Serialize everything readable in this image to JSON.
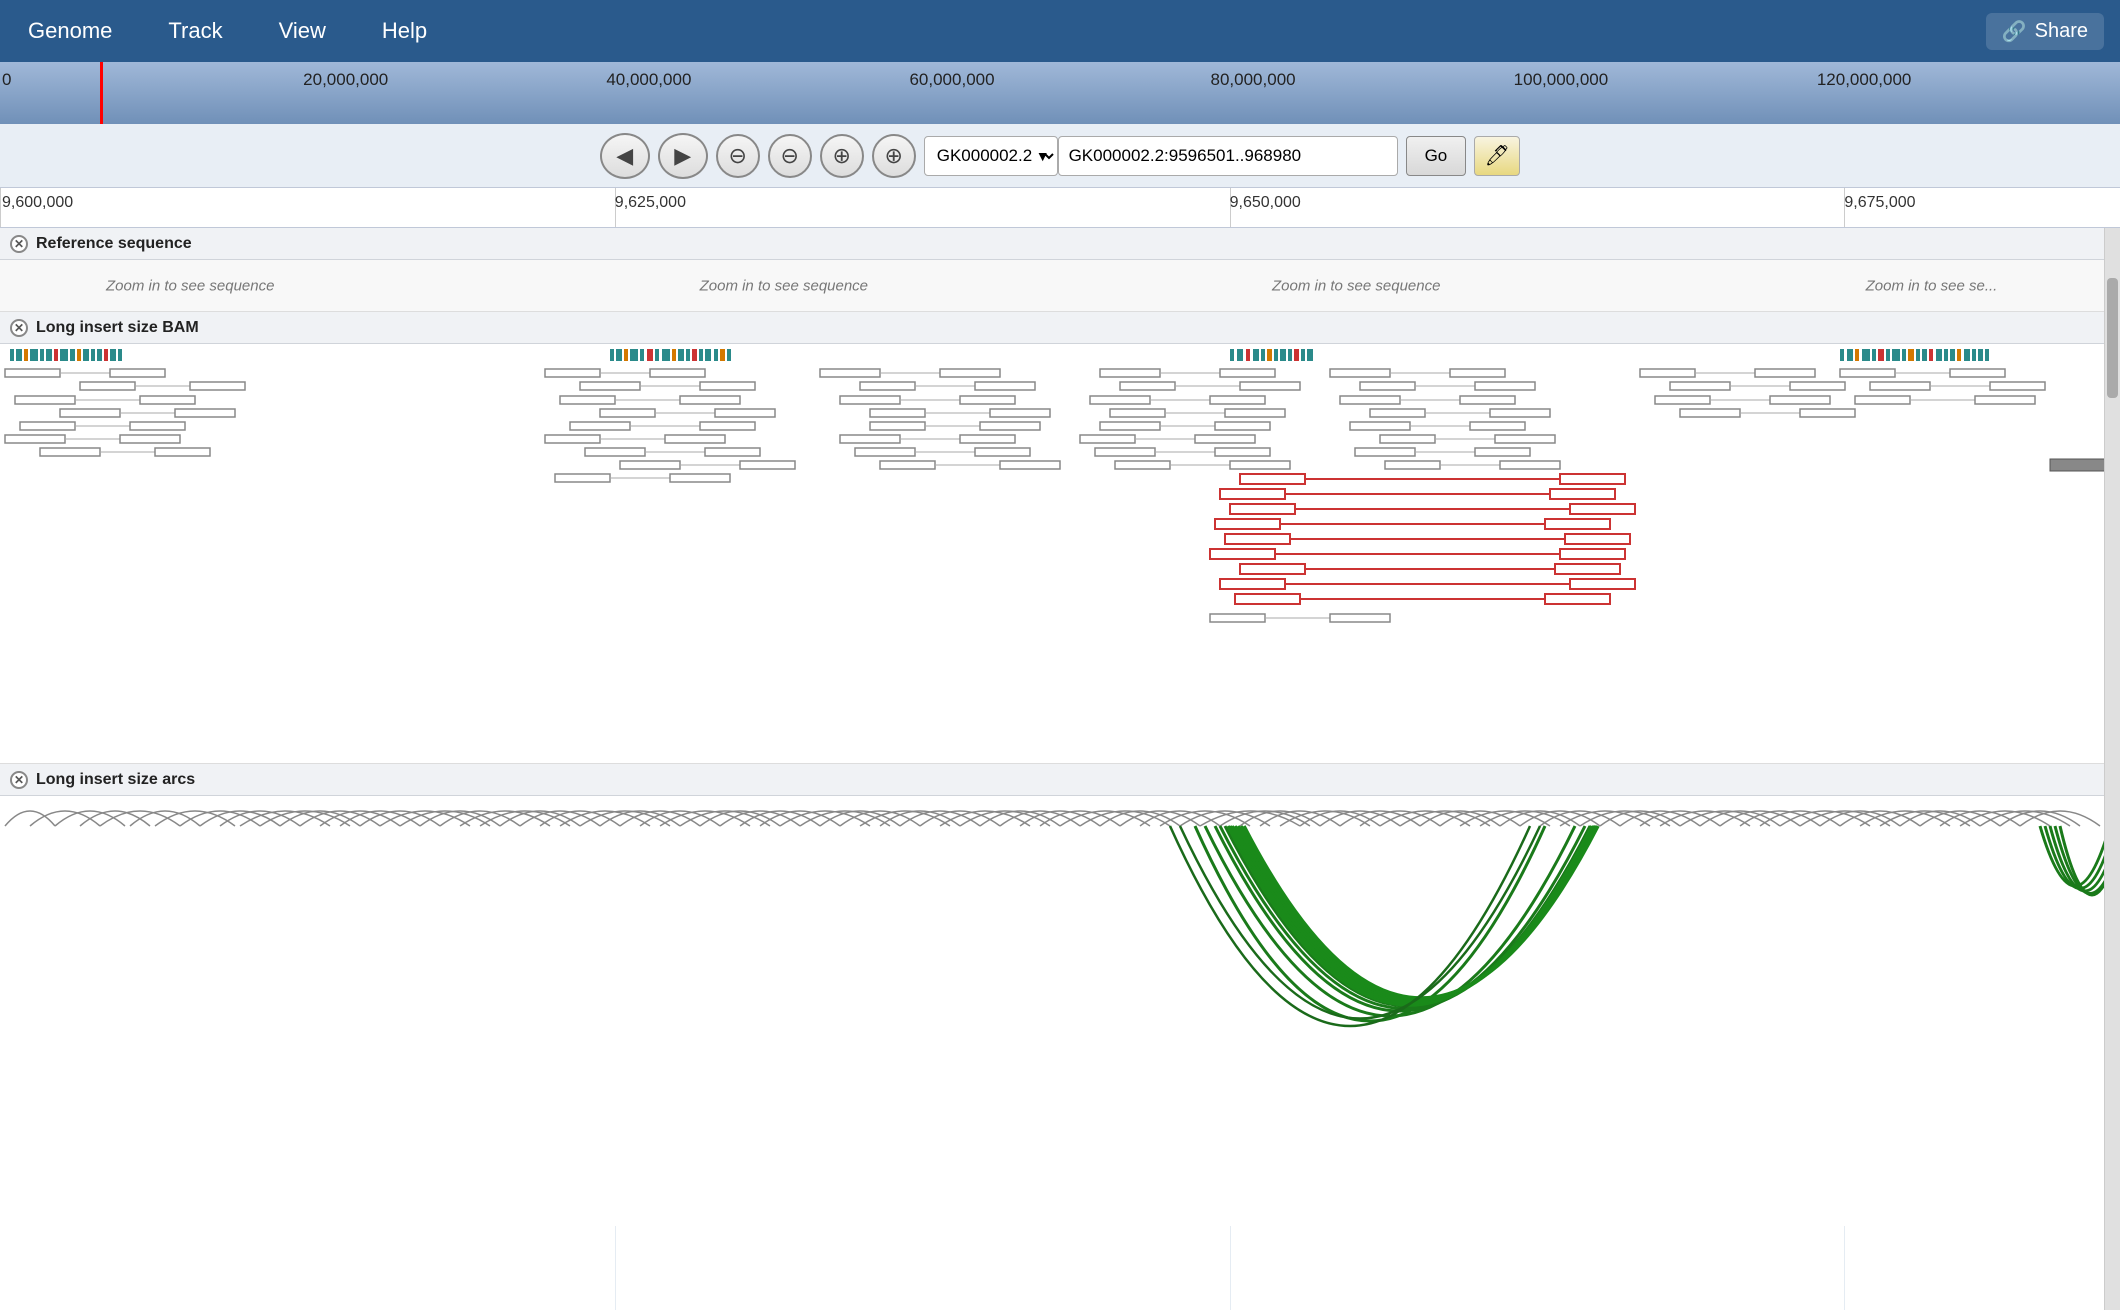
{
  "menubar": {
    "items": [
      "Genome",
      "Track",
      "View",
      "Help"
    ],
    "share_label": "Share",
    "share_icon": "🔗"
  },
  "chr_overview": {
    "ticks": [
      {
        "label": "0",
        "pct": 0
      },
      {
        "label": "20,000,000",
        "pct": 14.3
      },
      {
        "label": "40,000,000",
        "pct": 28.6
      },
      {
        "label": "60,000,000",
        "pct": 42.9
      },
      {
        "label": "80,000,000",
        "pct": 57.1
      },
      {
        "label": "100,000,000",
        "pct": 71.4
      },
      {
        "label": "120,000,000",
        "pct": 85.7
      }
    ]
  },
  "navbar": {
    "back_label": "◀",
    "forward_label": "▶",
    "zoom_out_large": "−−",
    "zoom_out_small": "−",
    "zoom_in_small": "+",
    "zoom_in_large": "++",
    "chr_value": "GK000002.2",
    "location_value": "GK000002.2:9596501..968980",
    "go_label": "Go",
    "highlight_icon": "✏️"
  },
  "detail_ruler": {
    "ticks": [
      {
        "label": "9,600,000",
        "pct": 0
      },
      {
        "label": "9,625,000",
        "pct": 29
      },
      {
        "label": "9,650,000",
        "pct": 58
      },
      {
        "label": "9,675,000",
        "pct": 87
      }
    ]
  },
  "tracks": {
    "reference": {
      "label": "Reference sequence",
      "zoom_messages": [
        {
          "text": "Zoom in to see sequence",
          "pct": 10
        },
        {
          "text": "Zoom in to see sequence",
          "pct": 38
        },
        {
          "text": "Zoom in to see sequence",
          "pct": 65
        },
        {
          "text": "Zoom in to see s",
          "pct": 88
        }
      ]
    },
    "bam": {
      "label": "Long insert size BAM"
    },
    "arcs": {
      "label": "Long insert size arcs"
    }
  },
  "colors": {
    "menu_bg": "#2a5a8c",
    "teal": "#2a8a8a",
    "red": "#cc3333",
    "green": "#1a8a1a",
    "orange": "#d47800",
    "gray": "#888888"
  }
}
